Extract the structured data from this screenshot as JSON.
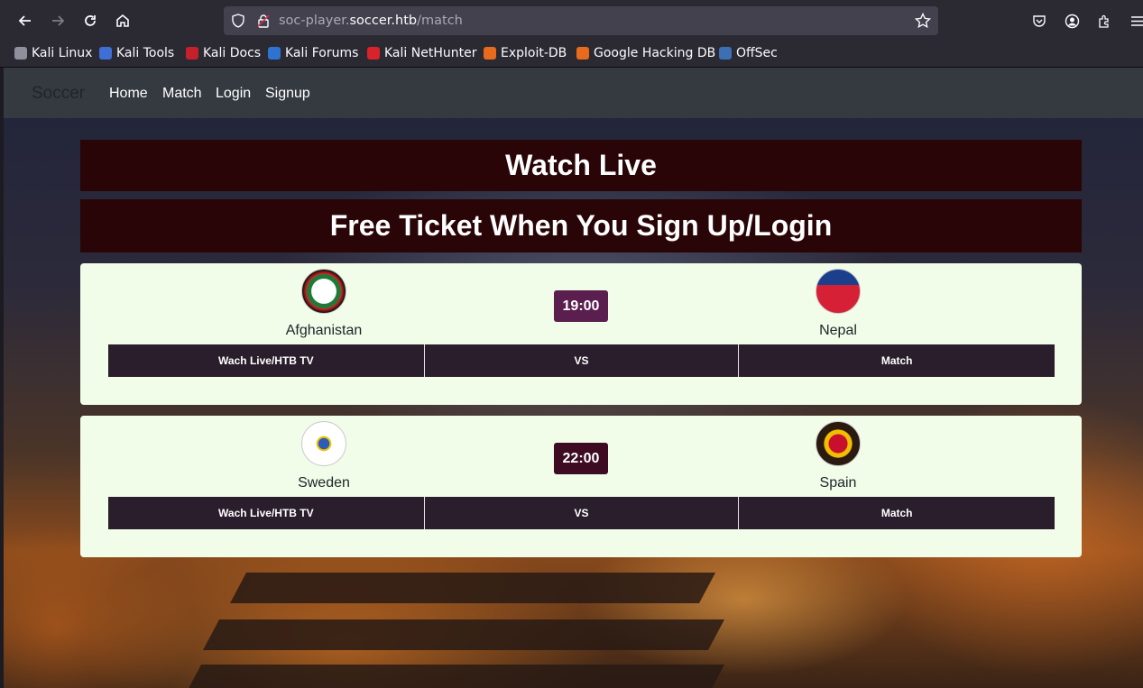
{
  "browser": {
    "url_scheme_part": "soc-player.",
    "url_host": "soccer.htb",
    "url_path": "/match",
    "bookmarks": [
      {
        "label": "Kali Linux",
        "icon": "kali-dragon-icon",
        "color": "#8f8f9d"
      },
      {
        "label": "Kali Tools",
        "icon": "kali-tools-icon",
        "color": "#3f6fd6"
      },
      {
        "label": "Kali Docs",
        "icon": "kali-docs-icon",
        "color": "#c6202b"
      },
      {
        "label": "Kali Forums",
        "icon": "kali-forums-icon",
        "color": "#2e72d2"
      },
      {
        "label": "Kali NetHunter",
        "icon": "nethunter-icon",
        "color": "#d8232a"
      },
      {
        "label": "Exploit-DB",
        "icon": "exploit-db-icon",
        "color": "#e86a1c"
      },
      {
        "label": "Google Hacking DB",
        "icon": "ghdb-icon",
        "color": "#e86a1c"
      },
      {
        "label": "OffSec",
        "icon": "offsec-icon",
        "color": "#3c6fb4"
      }
    ]
  },
  "navbar": {
    "brand": "Soccer",
    "links": [
      "Home",
      "Match",
      "Login",
      "Signup"
    ]
  },
  "banners": {
    "watch": "Watch Live",
    "ticket": "Free Ticket When You Sign Up/Login"
  },
  "matches": [
    {
      "home": "Afghanistan",
      "away": "Nepal",
      "time": "19:00",
      "time_color": "#5b1f4f",
      "actions": [
        "Wach Live/HTB TV",
        "VS",
        "Match"
      ]
    },
    {
      "home": "Sweden",
      "away": "Spain",
      "time": "22:00",
      "time_color": "#3d0b22",
      "actions": [
        "Wach Live/HTB TV",
        "VS",
        "Match"
      ]
    }
  ]
}
